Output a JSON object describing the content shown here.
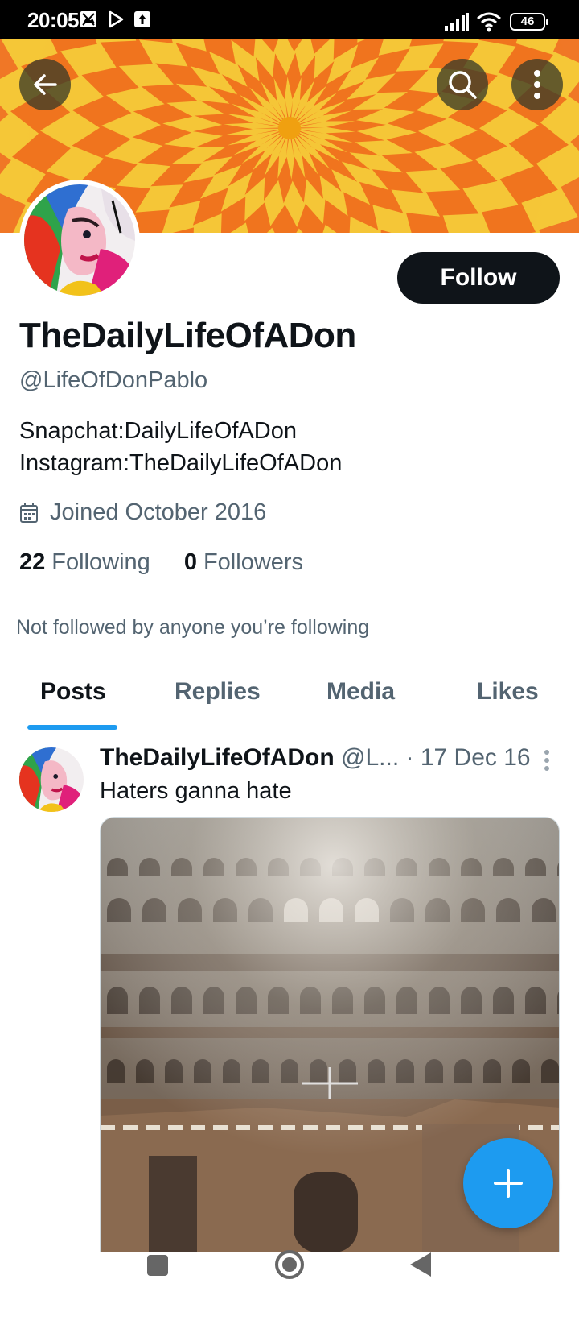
{
  "status_bar": {
    "time": "20:05",
    "battery": "46",
    "icons": [
      "gallery-notification-icon",
      "play-store-icon",
      "upload-icon",
      "signal-icon",
      "wifi-icon",
      "battery-icon"
    ]
  },
  "header": {
    "back_icon": "arrow-left-icon",
    "search_icon": "search-icon",
    "more_icon": "more-vertical-icon"
  },
  "profile": {
    "display_name": "TheDailyLifeOfADon",
    "handle": "@LifeOfDonPablo",
    "follow_label": "Follow",
    "bio_line1": "Snapchat:DailyLifeOfADon",
    "bio_line2": "Instagram:TheDailyLifeOfADon",
    "joined": "Joined October 2016",
    "following_count": "22",
    "following_label": "Following",
    "followers_count": "0",
    "followers_label": "Followers",
    "not_followed_text": "Not followed by anyone you’re following"
  },
  "tabs": [
    {
      "label": "Posts",
      "active": true
    },
    {
      "label": "Replies",
      "active": false
    },
    {
      "label": "Media",
      "active": false
    },
    {
      "label": "Likes",
      "active": false
    }
  ],
  "post": {
    "name": "TheDailyLifeOfADon",
    "handle": "@L...",
    "date": "· 17 Dec 16",
    "text": "Haters ganna hate"
  },
  "colors": {
    "accent": "#1d9bf0",
    "text_primary": "#0f1419",
    "text_secondary": "#536471",
    "follow_button": "#0f1419"
  },
  "nav_bar": {
    "icons": [
      "square-recents-icon",
      "circle-home-icon",
      "triangle-back-icon"
    ]
  }
}
